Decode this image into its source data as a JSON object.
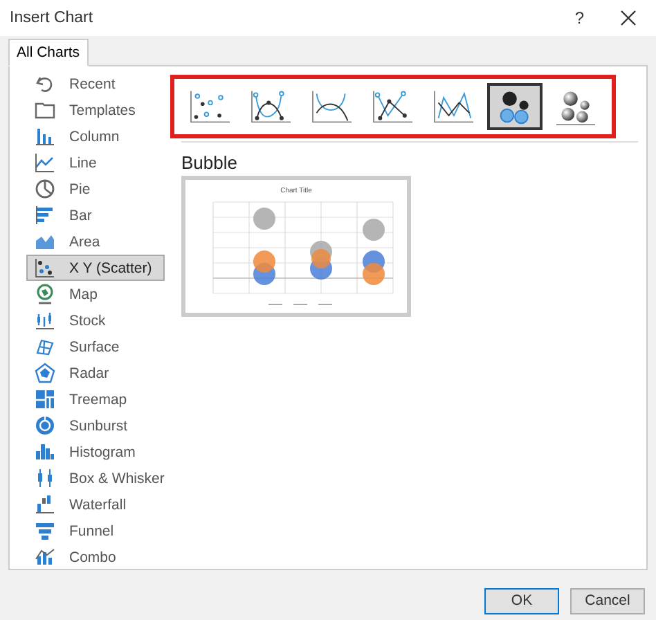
{
  "window": {
    "title": "Insert Chart",
    "help": "?"
  },
  "tabs": [
    {
      "label": "All Charts",
      "selected": true
    }
  ],
  "sidebar": {
    "items": [
      {
        "label": "Recent",
        "kind": "recent",
        "selected": false
      },
      {
        "label": "Templates",
        "kind": "templates",
        "selected": false
      },
      {
        "label": "Column",
        "kind": "column",
        "selected": false
      },
      {
        "label": "Line",
        "kind": "line",
        "selected": false
      },
      {
        "label": "Pie",
        "kind": "pie",
        "selected": false
      },
      {
        "label": "Bar",
        "kind": "bar",
        "selected": false
      },
      {
        "label": "Area",
        "kind": "area",
        "selected": false
      },
      {
        "label": "X Y (Scatter)",
        "kind": "scatter",
        "selected": true
      },
      {
        "label": "Map",
        "kind": "map",
        "selected": false
      },
      {
        "label": "Stock",
        "kind": "stock",
        "selected": false
      },
      {
        "label": "Surface",
        "kind": "surface",
        "selected": false
      },
      {
        "label": "Radar",
        "kind": "radar",
        "selected": false
      },
      {
        "label": "Treemap",
        "kind": "treemap",
        "selected": false
      },
      {
        "label": "Sunburst",
        "kind": "sunburst",
        "selected": false
      },
      {
        "label": "Histogram",
        "kind": "histogram",
        "selected": false
      },
      {
        "label": "Box & Whisker",
        "kind": "box",
        "selected": false
      },
      {
        "label": "Waterfall",
        "kind": "waterfall",
        "selected": false
      },
      {
        "label": "Funnel",
        "kind": "funnel",
        "selected": false
      },
      {
        "label": "Combo",
        "kind": "combo",
        "selected": false
      }
    ]
  },
  "subtypes": {
    "highlighted": true,
    "items": [
      {
        "kind": "scatter",
        "selected": false
      },
      {
        "kind": "smooth-markers",
        "selected": false
      },
      {
        "kind": "smooth",
        "selected": false
      },
      {
        "kind": "straight-markers",
        "selected": false
      },
      {
        "kind": "straight",
        "selected": false
      },
      {
        "kind": "bubble",
        "selected": true
      },
      {
        "kind": "bubble-3d",
        "selected": false
      }
    ]
  },
  "preview": {
    "heading": "Bubble",
    "chart_title": "Chart Title"
  },
  "buttons": [
    {
      "label": "OK",
      "kind": "default"
    },
    {
      "label": "Cancel",
      "kind": "normal"
    }
  ]
}
